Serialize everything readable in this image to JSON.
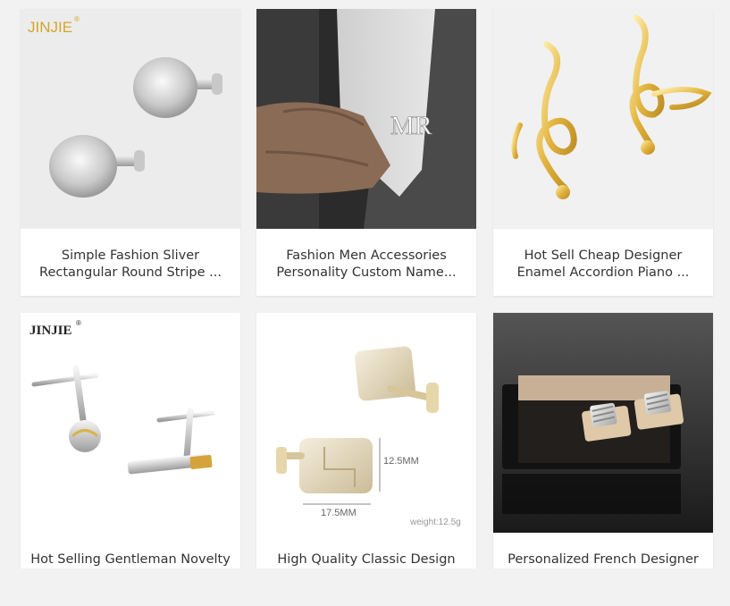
{
  "products": [
    {
      "brand": "JINJIE",
      "title_line1": "Simple Fashion Sliver",
      "title_line2": "Rectangular Round Stripe ..."
    },
    {
      "engraving": "MR",
      "title_line1": "Fashion Men Accessories",
      "title_line2": "Personality Custom Name..."
    },
    {
      "title_line1": "Hot Sell Cheap Designer",
      "title_line2": "Enamel Accordion Piano ..."
    },
    {
      "brand": "JINJIE",
      "title_line1": "Hot Selling Gentleman Novelty",
      "title_line2": ""
    },
    {
      "dim_height": "12.5MM",
      "dim_width": "17.5MM",
      "weight": "weight:12.5g",
      "title_line1": "High Quality Classic Design",
      "title_line2": ""
    },
    {
      "title_line1": "Personalized French Designer",
      "title_line2": ""
    }
  ],
  "colors": {
    "page_bg": "#f2f2f2",
    "card_bg": "#ffffff",
    "title_text": "#333333",
    "brand_gold": "#d4a62a"
  }
}
